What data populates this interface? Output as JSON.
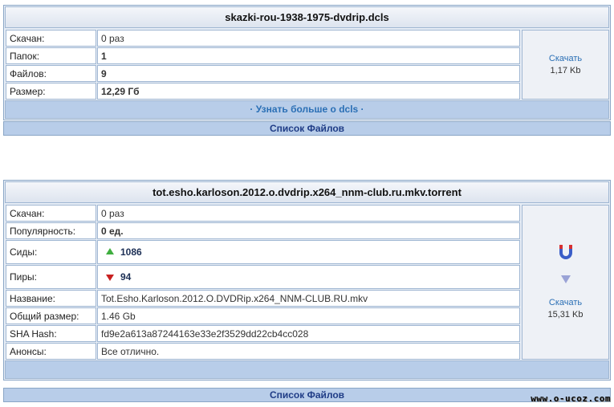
{
  "panel1": {
    "title": "skazki-rou-1938-1975-dvdrip.dcls",
    "rows": [
      {
        "label": "Скачан:",
        "value": "0 раз"
      },
      {
        "label": "Папок:",
        "value": "1"
      },
      {
        "label": "Файлов:",
        "value": "9"
      },
      {
        "label": "Размер:",
        "value": "12,29 Гб"
      }
    ],
    "download_label": "Скачать",
    "download_size": "1,17 Kb",
    "more_label": "· Узнать больше о dcls ·",
    "files_label": "Список Файлов"
  },
  "panel2": {
    "title": "tot.esho.karloson.2012.o.dvdrip.x264_nnm-club.ru.mkv.torrent",
    "rows": [
      {
        "label": "Скачан:",
        "value": "0 раз"
      },
      {
        "label": "Популярность:",
        "value": "0 ед."
      },
      {
        "label": "Сиды:",
        "value": "1086"
      },
      {
        "label": "Пиры:",
        "value": "94"
      },
      {
        "label": "Название:",
        "value": "Tot.Esho.Karloson.2012.O.DVDRip.x264_NNM-CLUB.RU.mkv"
      },
      {
        "label": "Общий размер:",
        "value": "1.46 Gb"
      },
      {
        "label": "SHA Hash:",
        "value": "fd9e2a613a87244163e33e2f3529dd22cb4cc028"
      },
      {
        "label": "Анонсы:",
        "value": "Все отлично."
      }
    ],
    "download_label": "Скачать",
    "download_size": "15,31 Kb",
    "files_label": "Список Файлов"
  },
  "watermark": "www.o-ucoz.com",
  "colors": {
    "link": "#2a6fb5",
    "bar": "#b8cde9",
    "seed_up": "#3fae3f",
    "peer_down": "#c82020",
    "magnet": "#3a5ec8"
  },
  "icons": {
    "seeds": "arrow-up-icon",
    "peers": "arrow-down-icon",
    "magnet": "magnet-icon",
    "down": "triangle-down-icon"
  }
}
